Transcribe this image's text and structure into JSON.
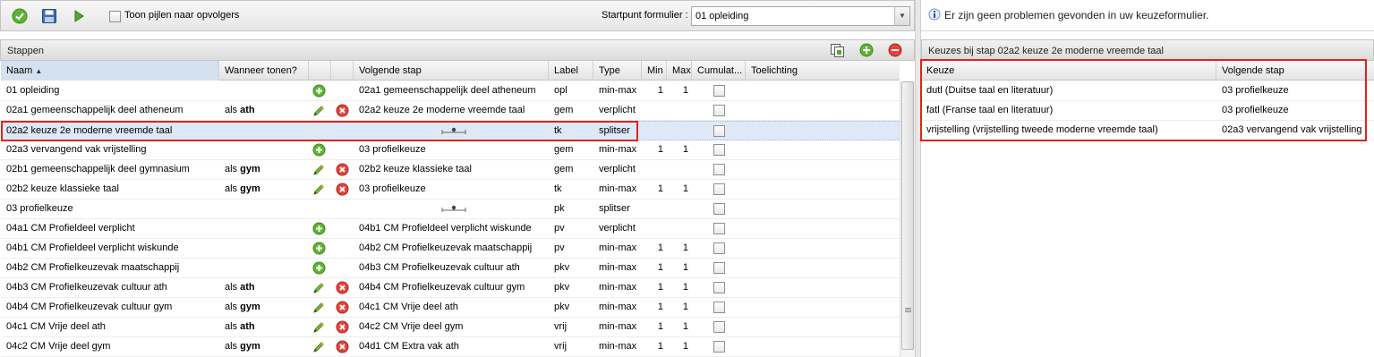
{
  "toolbar": {
    "checkbox_label": "Toon pijlen naar opvolgers",
    "startpoint_label": "Startpunt formulier :",
    "startpoint_value": "01 opleiding",
    "icons": [
      "check-icon",
      "save-icon",
      "play-icon"
    ]
  },
  "steps_panel": {
    "title": "Stappen",
    "columns": {
      "naam": "Naam",
      "wanneer": "Wanneer tonen?",
      "volgende": "Volgende stap",
      "label": "Label",
      "type": "Type",
      "min": "Min",
      "max": "Max",
      "cumulatief": "Cumulat...",
      "toelichting": "Toelichting"
    },
    "rows": [
      {
        "naam": "01 opleiding",
        "wanneer_prefix": "",
        "wanneer_bold": "",
        "volgende": "02a1 gemeenschappelijk deel atheneum",
        "label": "opl",
        "type": "min-max",
        "min": "1",
        "max": "1",
        "action": "add"
      },
      {
        "naam": "02a1 gemeenschappelijk deel atheneum",
        "wanneer_prefix": "als ",
        "wanneer_bold": "ath",
        "volgende": "02a2 keuze 2e moderne vreemde taal",
        "label": "gem",
        "type": "verplicht",
        "min": "",
        "max": "",
        "action": "edit-delete"
      },
      {
        "naam": "02a2 keuze 2e moderne vreemde taal",
        "wanneer_prefix": "",
        "wanneer_bold": "",
        "volgende": "",
        "label": "tk",
        "type": "splitser",
        "min": "",
        "max": "",
        "action": "split",
        "selected": true
      },
      {
        "naam": "02a3 vervangend vak vrijstelling",
        "wanneer_prefix": "",
        "wanneer_bold": "",
        "volgende": "03 profielkeuze",
        "label": "gem",
        "type": "min-max",
        "min": "1",
        "max": "1",
        "action": "add"
      },
      {
        "naam": "02b1 gemeenschappelijk deel gymnasium",
        "wanneer_prefix": "als ",
        "wanneer_bold": "gym",
        "volgende": "02b2 keuze klassieke taal",
        "label": "gem",
        "type": "verplicht",
        "min": "",
        "max": "",
        "action": "edit-delete"
      },
      {
        "naam": "02b2 keuze klassieke taal",
        "wanneer_prefix": "als ",
        "wanneer_bold": "gym",
        "volgende": "03 profielkeuze",
        "label": "tk",
        "type": "min-max",
        "min": "1",
        "max": "1",
        "action": "edit-delete"
      },
      {
        "naam": "03 profielkeuze",
        "wanneer_prefix": "",
        "wanneer_bold": "",
        "volgende": "",
        "label": "pk",
        "type": "splitser",
        "min": "",
        "max": "",
        "action": "split"
      },
      {
        "naam": "04a1 CM Profieldeel verplicht",
        "wanneer_prefix": "",
        "wanneer_bold": "",
        "volgende": "04b1 CM Profieldeel verplicht wiskunde",
        "label": "pv",
        "type": "verplicht",
        "min": "",
        "max": "",
        "action": "add"
      },
      {
        "naam": "04b1 CM Profieldeel verplicht wiskunde",
        "wanneer_prefix": "",
        "wanneer_bold": "",
        "volgende": "04b2 CM Profielkeuzevak maatschappij",
        "label": "pv",
        "type": "min-max",
        "min": "1",
        "max": "1",
        "action": "add"
      },
      {
        "naam": "04b2 CM Profielkeuzevak maatschappij",
        "wanneer_prefix": "",
        "wanneer_bold": "",
        "volgende": "04b3 CM Profielkeuzevak cultuur ath",
        "label": "pkv",
        "type": "min-max",
        "min": "1",
        "max": "1",
        "action": "add"
      },
      {
        "naam": "04b3 CM Profielkeuzevak cultuur ath",
        "wanneer_prefix": "als ",
        "wanneer_bold": "ath",
        "volgende": "04b4 CM Profielkeuzevak cultuur gym",
        "label": "pkv",
        "type": "min-max",
        "min": "1",
        "max": "1",
        "action": "edit-delete"
      },
      {
        "naam": "04b4 CM Profielkeuzevak cultuur gym",
        "wanneer_prefix": "als ",
        "wanneer_bold": "gym",
        "volgende": "04c1 CM Vrije deel ath",
        "label": "pkv",
        "type": "min-max",
        "min": "1",
        "max": "1",
        "action": "edit-delete"
      },
      {
        "naam": "04c1 CM Vrije deel ath",
        "wanneer_prefix": "als ",
        "wanneer_bold": "ath",
        "volgende": "04c2 CM Vrije deel gym",
        "label": "vrij",
        "type": "min-max",
        "min": "1",
        "max": "1",
        "action": "edit-delete"
      },
      {
        "naam": "04c2 CM Vrije deel gym",
        "wanneer_prefix": "als ",
        "wanneer_bold": "gym",
        "volgende": "04d1 CM Extra vak ath",
        "label": "vrij",
        "type": "min-max",
        "min": "1",
        "max": "1",
        "action": "edit-delete"
      }
    ]
  },
  "message": {
    "text": "Er zijn geen problemen gevonden in uw keuzeformulier."
  },
  "choices_panel": {
    "title": "Keuzes bij stap 02a2 keuze 2e moderne vreemde taal",
    "columns": {
      "keuze": "Keuze",
      "volgende": "Volgende stap"
    },
    "rows": [
      {
        "keuze": "dutl (Duitse taal en literatuur)",
        "volgende": "03 profielkeuze"
      },
      {
        "keuze": "fatl (Franse taal en literatuur)",
        "volgende": "03 profielkeuze"
      },
      {
        "keuze": "vrijstelling (vrijstelling tweede moderne vreemde taal)",
        "volgende": "02a3 vervangend vak vrijstelling"
      }
    ]
  },
  "colors": {
    "accent_red": "#e0231c",
    "selected_row": "#dfe8f6",
    "sort_header": "#d3e1f1"
  }
}
